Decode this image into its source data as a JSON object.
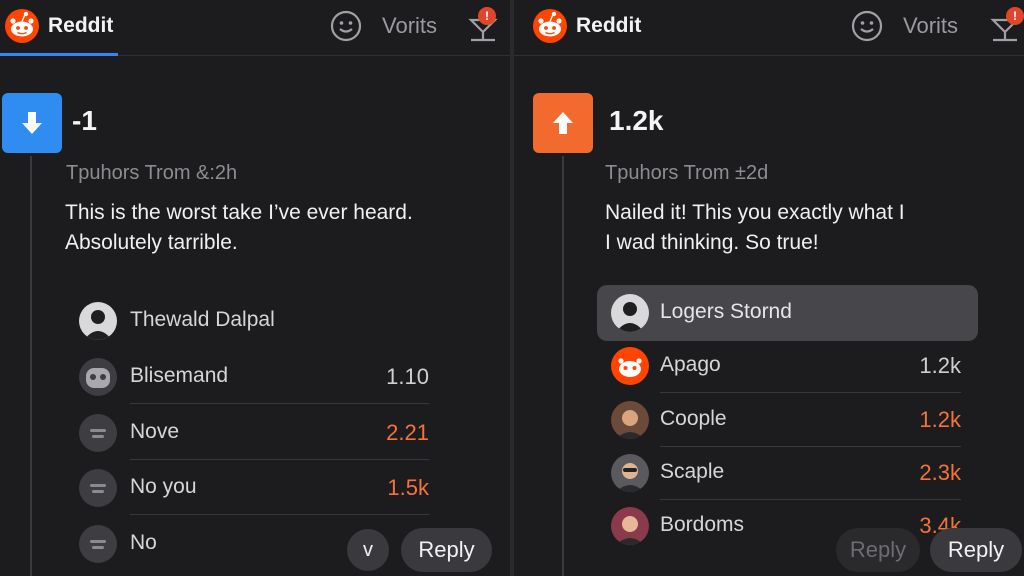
{
  "app": {
    "name": "Reddit",
    "vorits_label": "Vorits",
    "notification_badge": "!"
  },
  "colors": {
    "downvote": "#2f8cf0",
    "upvote": "#f26a2e",
    "accent_orange": "#f4733a",
    "tab_underline": "#3b82f6"
  },
  "left": {
    "vote_direction": "down",
    "score": "-1",
    "meta": "Tpuhors Trom &:2h",
    "body_line1": "This is the worst take I’ve ever heard.",
    "body_line2": "Absolutely tarrible.",
    "replies": [
      {
        "name": "Thewald Dalpal",
        "value": "",
        "avatar": "person-avatar"
      },
      {
        "name": "Blisemand",
        "value": "1.10",
        "value_color": "white",
        "avatar": "discord-avatar"
      },
      {
        "name": "Nove",
        "value": "2.21",
        "value_color": "orange",
        "avatar": "default-avatar"
      },
      {
        "name": "No you",
        "value": "1.5k",
        "value_color": "orange",
        "avatar": "default-avatar"
      },
      {
        "name": "No",
        "value": "",
        "avatar": "default-avatar"
      }
    ],
    "collapse_label": "v",
    "reply_label": "Reply"
  },
  "right": {
    "vote_direction": "up",
    "score": "1.2k",
    "meta": "Tpuhors Trom ±2d",
    "body_line1": "Nailed it! This you exactly what I",
    "body_line2": "I wad thinking. So true!",
    "replies": [
      {
        "name": "Logers Stornd",
        "value": "",
        "avatar": "person-avatar",
        "highlighted": true
      },
      {
        "name": "Apago",
        "value": "1.2k",
        "value_color": "white",
        "avatar": "reddit-avatar"
      },
      {
        "name": "Coople",
        "value": "1.2k",
        "value_color": "orange",
        "avatar": "person-avatar"
      },
      {
        "name": "Scaple",
        "value": "2.3k",
        "value_color": "orange",
        "avatar": "person-avatar"
      },
      {
        "name": "Bordoms",
        "value": "3.4k",
        "value_color": "orange",
        "avatar": "person-avatar"
      }
    ],
    "ghost_reply_label": "Reply",
    "reply_label": "Reply"
  }
}
